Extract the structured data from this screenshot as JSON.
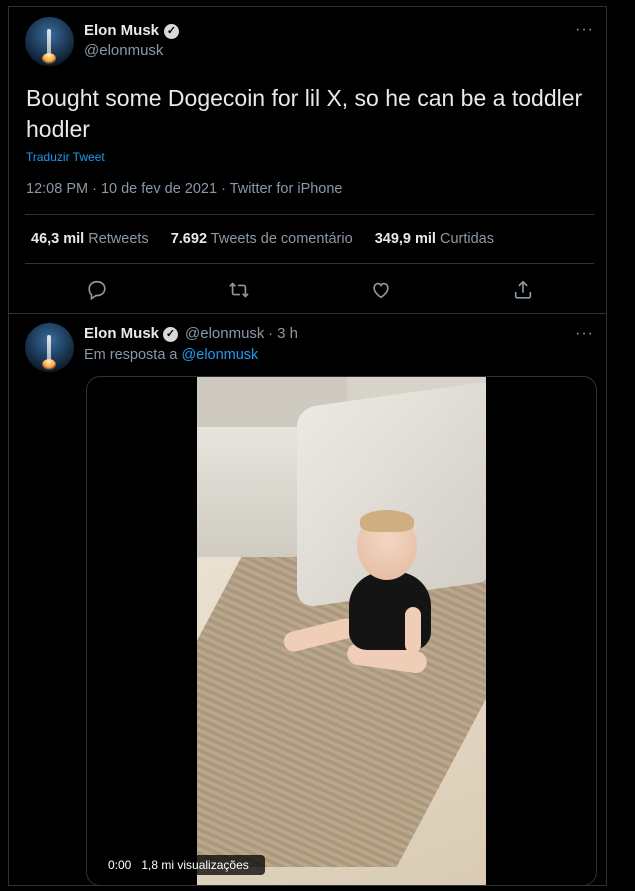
{
  "tweet": {
    "name": "Elon Musk",
    "handle": "@elonmusk",
    "verified_glyph": "✓",
    "more_glyph": "···",
    "text": "Bought some Dogecoin for lil X, so he can be a toddler hodler",
    "translate_label": "Traduzir Tweet",
    "meta": "12:08 PM · 10 de fev de 2021 · Twitter for iPhone",
    "stats": [
      {
        "count": "46,3 mil",
        "label": "Retweets"
      },
      {
        "count": "7.692",
        "label": "Tweets de comentário"
      },
      {
        "count": "349,9 mil",
        "label": "Curtidas"
      }
    ],
    "actions": [
      "reply-icon",
      "retweet-icon",
      "like-icon",
      "share-icon"
    ]
  },
  "reply": {
    "name": "Elon Musk",
    "handle": "@elonmusk",
    "time": "· 3 h",
    "more_glyph": "···",
    "in_reply_prefix": "Em resposta a",
    "in_reply_handle": "@elonmusk",
    "video": {
      "time": "0:00",
      "views": "1,8 mi visualizações"
    }
  },
  "colors": {
    "background": "#000000",
    "accent": "#1d9bf0",
    "muted": "#8b98a5",
    "border": "#2f3336"
  }
}
